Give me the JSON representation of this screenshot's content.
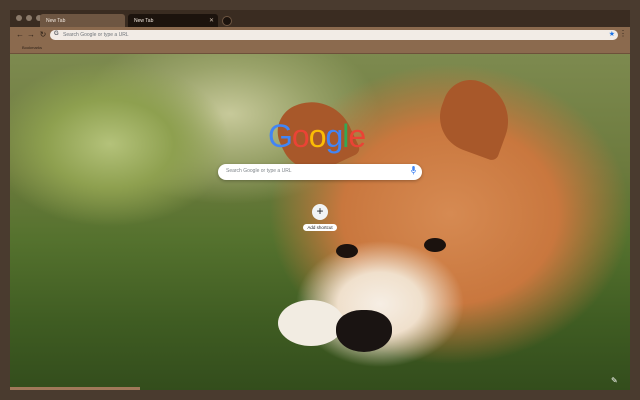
{
  "tabs": [
    {
      "label": "New Tab"
    },
    {
      "label": "New Tab"
    }
  ],
  "toolbar": {
    "omnibox_placeholder": "Search Google or type a URL"
  },
  "bookmarks": {
    "label": "Bookmarks"
  },
  "ntp": {
    "logo_letters": [
      "G",
      "o",
      "o",
      "g",
      "l",
      "e"
    ],
    "logo_colors": [
      "#4285f4",
      "#ea4335",
      "#fbbc05",
      "#4285f4",
      "#34a853",
      "#ea4335"
    ],
    "search_placeholder": "Search Google or type a URL",
    "add_shortcut_label": "Add shortcut"
  },
  "colors": {
    "frame": "#4a3b2f",
    "toolbar": "#8b6a4e",
    "active_tab": "#1c130d"
  },
  "icons": [
    "back-icon",
    "forward-icon",
    "reload-icon",
    "google-g-icon",
    "star-icon",
    "menu-icon",
    "mic-icon",
    "plus-icon",
    "customize-icon"
  ]
}
